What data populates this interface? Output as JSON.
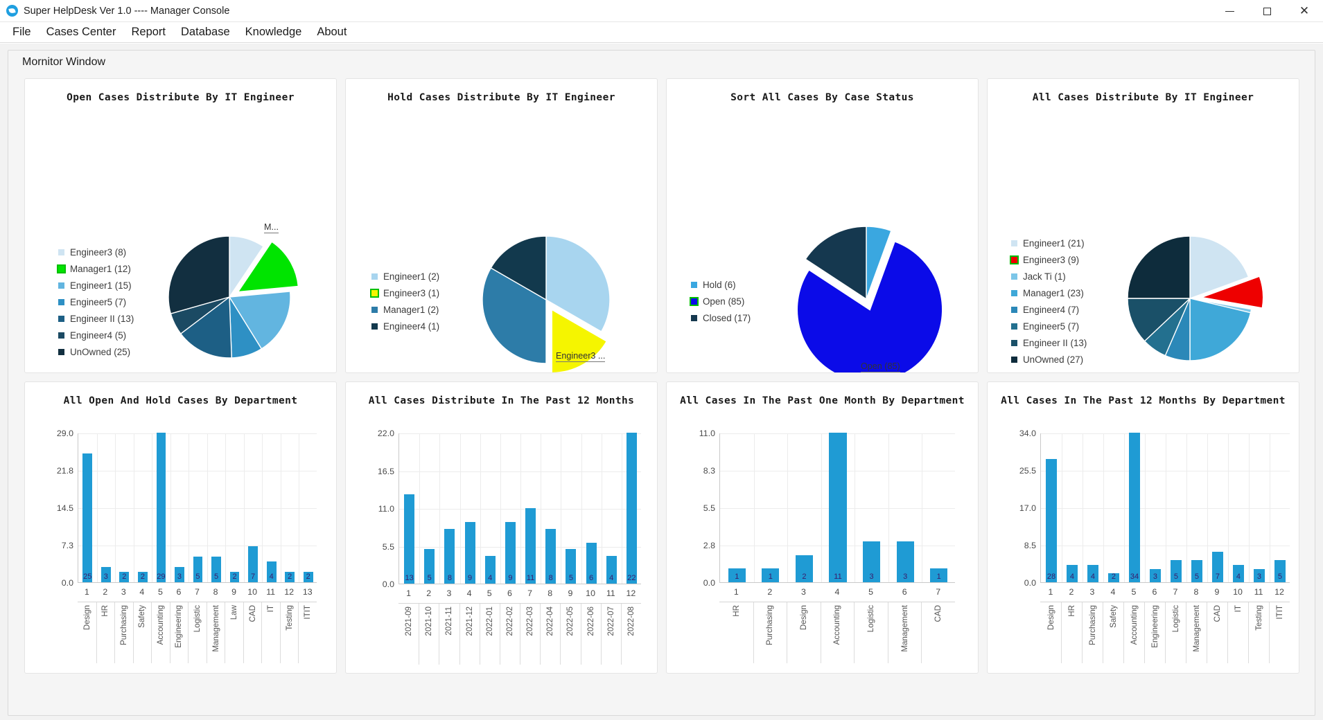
{
  "window": {
    "title": "Super HelpDesk Ver 1.0  ---- Manager Console",
    "app_icon": "bird-icon",
    "minimize": "minimize-icon",
    "maximize": "maximize-icon",
    "close": "✕"
  },
  "menu": [
    {
      "label": "File"
    },
    {
      "label": "Cases Center"
    },
    {
      "label": "Report"
    },
    {
      "label": "Database"
    },
    {
      "label": "Knowledge"
    },
    {
      "label": "About"
    }
  ],
  "panel": {
    "title": "Mornitor Window"
  },
  "chart_data": [
    {
      "type": "pie",
      "title": "Open Cases Distribute By IT Engineer",
      "legend_position": "left",
      "exploded_slice": "Manager1",
      "callout": "M...",
      "categories": [
        "Engineer3",
        "Manager1",
        "Engineer1",
        "Engineer5",
        "Engineer II",
        "Engineer4",
        "UnOwned"
      ],
      "values": [
        8,
        12,
        15,
        7,
        13,
        5,
        25
      ],
      "labels": [
        "Engineer3 (8)",
        "Manager1 (12)",
        "Engineer1 (15)",
        "Engineer5 (7)",
        "Engineer II (13)",
        "Engineer4 (5)",
        "UnOwned (25)"
      ],
      "colors": [
        "#cfe4f2",
        "#00e400",
        "#62b5e0",
        "#2e90c4",
        "#1d5f85",
        "#1b4a63",
        "#122f40"
      ]
    },
    {
      "type": "pie",
      "title": "Hold Cases Distribute By IT Engineer",
      "legend_position": "left",
      "exploded_slice": "Engineer3",
      "callout": "Engineer3 ...",
      "categories": [
        "Engineer1",
        "Engineer3",
        "Manager1",
        "Engineer4"
      ],
      "values": [
        2,
        1,
        2,
        1
      ],
      "labels": [
        "Engineer1 (2)",
        "Engineer3 (1)",
        "Manager1 (2)",
        "Engineer4 (1)"
      ],
      "colors": [
        "#a8d5ef",
        "#f5f500",
        "#2d7ca8",
        "#12394d"
      ]
    },
    {
      "type": "pie",
      "title": "Sort All Cases By Case Status",
      "legend_position": "left",
      "exploded_slice": "Open",
      "callout": "Open (85)",
      "categories": [
        "Hold",
        "Open",
        "Closed"
      ],
      "values": [
        6,
        85,
        17
      ],
      "labels": [
        "Hold (6)",
        "Open (85)",
        "Closed (17)"
      ],
      "colors": [
        "#3aa7e0",
        "#0b0be8",
        "#15384f"
      ]
    },
    {
      "type": "pie",
      "title": "All Cases Distribute By IT Engineer",
      "legend_position": "left",
      "exploded_slice": "Engineer3",
      "callout": "",
      "categories": [
        "Engineer1",
        "Engineer3",
        "Jack Ti",
        "Manager1",
        "Engineer4",
        "Engineer5",
        "Engineer II",
        "UnOwned"
      ],
      "values": [
        21,
        9,
        1,
        23,
        7,
        7,
        13,
        27
      ],
      "labels": [
        "Engineer1 (21)",
        "Engineer3 (9)",
        "Jack Ti (1)",
        "Manager1 (23)",
        "Engineer4 (7)",
        "Engineer5 (7)",
        "Engineer II (13)",
        "UnOwned (27)"
      ],
      "colors": [
        "#cfe4f2",
        "#ee0000",
        "#7cc6e8",
        "#3fa8d8",
        "#2b88b8",
        "#23708f",
        "#1a5068",
        "#0e2c3c"
      ]
    },
    {
      "type": "bar",
      "title": "All Open And Hold Cases By Department",
      "xlabel": "",
      "ylabel": "",
      "ylim": [
        0,
        29
      ],
      "yticks": [
        "0.0",
        "7.3",
        "14.5",
        "21.8",
        "29.0"
      ],
      "indices": [
        "1",
        "2",
        "3",
        "4",
        "5",
        "6",
        "7",
        "8",
        "9",
        "10",
        "11",
        "12",
        "13"
      ],
      "categories": [
        "Design",
        "HR",
        "Purchasing",
        "Safety",
        "Accounting",
        "Engineering",
        "Logistic",
        "Management",
        "Law",
        "CAD",
        "IT",
        "Testing",
        "ITIT"
      ],
      "values": [
        25,
        3,
        2,
        2,
        29,
        3,
        5,
        5,
        2,
        7,
        4,
        2,
        2
      ],
      "bar_color": "#1f9bd4"
    },
    {
      "type": "bar",
      "title": "All Cases Distribute In The Past 12 Months",
      "xlabel": "",
      "ylabel": "",
      "ylim": [
        0,
        22
      ],
      "yticks": [
        "0.0",
        "5.5",
        "11.0",
        "16.5",
        "22.0"
      ],
      "indices": [
        "1",
        "2",
        "3",
        "4",
        "5",
        "6",
        "7",
        "8",
        "9",
        "10",
        "11",
        "12"
      ],
      "categories": [
        "2021-09",
        "2021-10",
        "2021-11",
        "2021-12",
        "2022-01",
        "2022-02",
        "2022-03",
        "2022-04",
        "2022-05",
        "2022-06",
        "2022-07",
        "2022-08"
      ],
      "values": [
        13,
        5,
        8,
        9,
        4,
        9,
        11,
        8,
        5,
        6,
        4,
        22
      ],
      "bar_color": "#1f9bd4"
    },
    {
      "type": "bar",
      "title": "All Cases In The Past One Month By Department",
      "xlabel": "",
      "ylabel": "",
      "ylim": [
        0,
        11
      ],
      "yticks": [
        "0.0",
        "2.8",
        "5.5",
        "8.3",
        "11.0"
      ],
      "indices": [
        "1",
        "2",
        "3",
        "4",
        "5",
        "6",
        "7"
      ],
      "categories": [
        "HR",
        "Purchasing",
        "Design",
        "Accounting",
        "Logistic",
        "Management",
        "CAD"
      ],
      "values": [
        1,
        1,
        2,
        11,
        3,
        3,
        1
      ],
      "bar_color": "#1f9bd4"
    },
    {
      "type": "bar",
      "title": "All Cases In The Past 12 Months By Department",
      "xlabel": "",
      "ylabel": "",
      "ylim": [
        0,
        34
      ],
      "yticks": [
        "0.0",
        "8.5",
        "17.0",
        "25.5",
        "34.0"
      ],
      "indices": [
        "1",
        "2",
        "3",
        "4",
        "5",
        "6",
        "7",
        "8",
        "9",
        "10",
        "11",
        "12"
      ],
      "categories": [
        "Design",
        "HR",
        "Purchasing",
        "Safety",
        "Accounting",
        "Engineering",
        "Logistic",
        "Management",
        "CAD",
        "IT",
        "Testing",
        "ITIT"
      ],
      "values": [
        28,
        4,
        4,
        2,
        34,
        3,
        5,
        5,
        7,
        4,
        3,
        5
      ],
      "bar_color": "#1f9bd4"
    }
  ]
}
